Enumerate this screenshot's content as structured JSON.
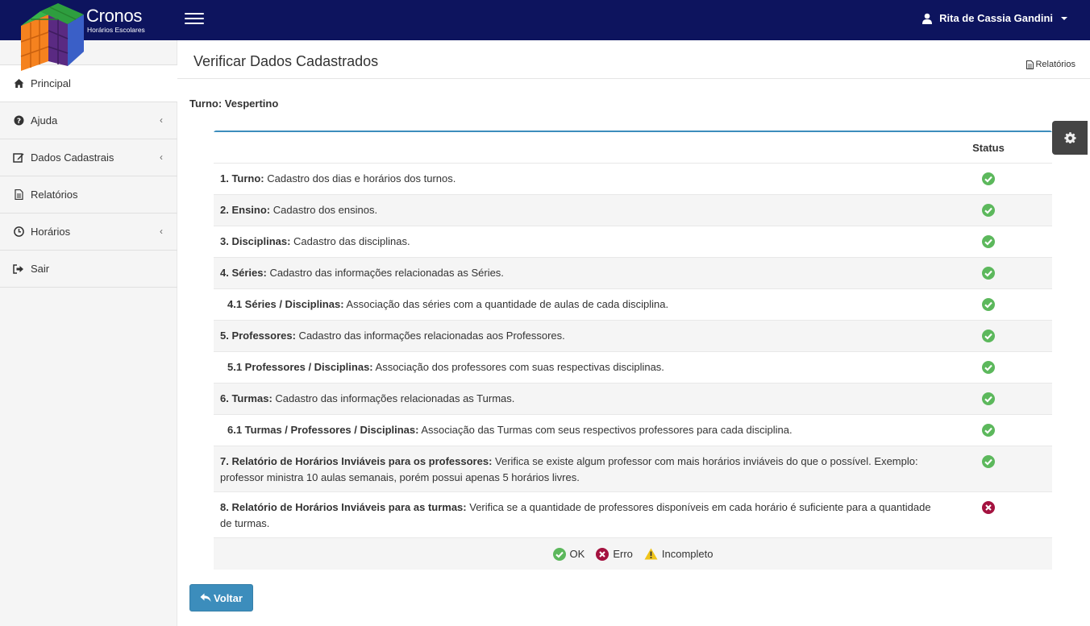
{
  "brand": {
    "title": "Cronos",
    "subtitle": "Horários Escolares"
  },
  "user": {
    "name": "Rita de Cassia Gandini"
  },
  "sidebar": {
    "items": [
      {
        "label": "Principal",
        "icon": "home-icon",
        "has_children": false
      },
      {
        "label": "Ajuda",
        "icon": "question-circle-icon",
        "has_children": true
      },
      {
        "label": "Dados Cadastrais",
        "icon": "edit-icon",
        "has_children": true
      },
      {
        "label": "Relatórios",
        "icon": "file-text-icon",
        "has_children": false
      },
      {
        "label": "Horários",
        "icon": "clock-icon",
        "has_children": true
      },
      {
        "label": "Sair",
        "icon": "sign-out-icon",
        "has_children": false
      }
    ]
  },
  "page": {
    "title": "Verificar Dados Cadastrados",
    "reports_link": "Relatórios",
    "turno": "Turno: Vespertino"
  },
  "table": {
    "status_header": "Status",
    "rows": [
      {
        "title": "1. Turno:",
        "desc": " Cadastro dos dias e horários dos turnos.",
        "status": "ok"
      },
      {
        "title": "2. Ensino:",
        "desc": " Cadastro dos ensinos.",
        "status": "ok"
      },
      {
        "title": "3. Disciplinas:",
        "desc": " Cadastro das disciplinas.",
        "status": "ok"
      },
      {
        "title": "4. Séries:",
        "desc": " Cadastro das informações relacionadas as Séries.",
        "status": "ok"
      },
      {
        "title": "4.1 Séries / Disciplinas:",
        "desc": " Associação das séries com a quantidade de aulas de cada disciplina.",
        "status": "ok"
      },
      {
        "title": "5. Professores:",
        "desc": " Cadastro das informações relacionadas aos Professores.",
        "status": "ok"
      },
      {
        "title": "5.1 Professores / Disciplinas:",
        "desc": " Associação dos professores com suas respectivas disciplinas.",
        "status": "ok"
      },
      {
        "title": "6. Turmas:",
        "desc": " Cadastro das informações relacionadas as Turmas.",
        "status": "ok"
      },
      {
        "title": "6.1 Turmas / Professores / Disciplinas:",
        "desc": " Associação das Turmas com seus respectivos professores para cada disciplina.",
        "status": "ok"
      },
      {
        "title": "7. Relatório de Horários Inviáveis para os professores:",
        "desc": " Verifica se existe algum professor com mais horários inviáveis do que o possível. Exemplo: professor ministra 10 aulas semanais, porém possui apenas 5 horários livres.",
        "status": "ok"
      },
      {
        "title": "8. Relatório de Horários Inviáveis para as turmas:",
        "desc": " Verifica se a quantidade de professores disponíveis em cada horário é suficiente para a quantidade de turmas.",
        "status": "error"
      }
    ]
  },
  "legend": {
    "ok": "OK",
    "error": "Erro",
    "incomplete": "Incompleto"
  },
  "buttons": {
    "back": "Voltar"
  },
  "colors": {
    "navbar": "#0d145e",
    "accent": "#3c8dbc",
    "ok": "#5cb85c",
    "error": "#a4123f",
    "warning": "#f0c419"
  }
}
